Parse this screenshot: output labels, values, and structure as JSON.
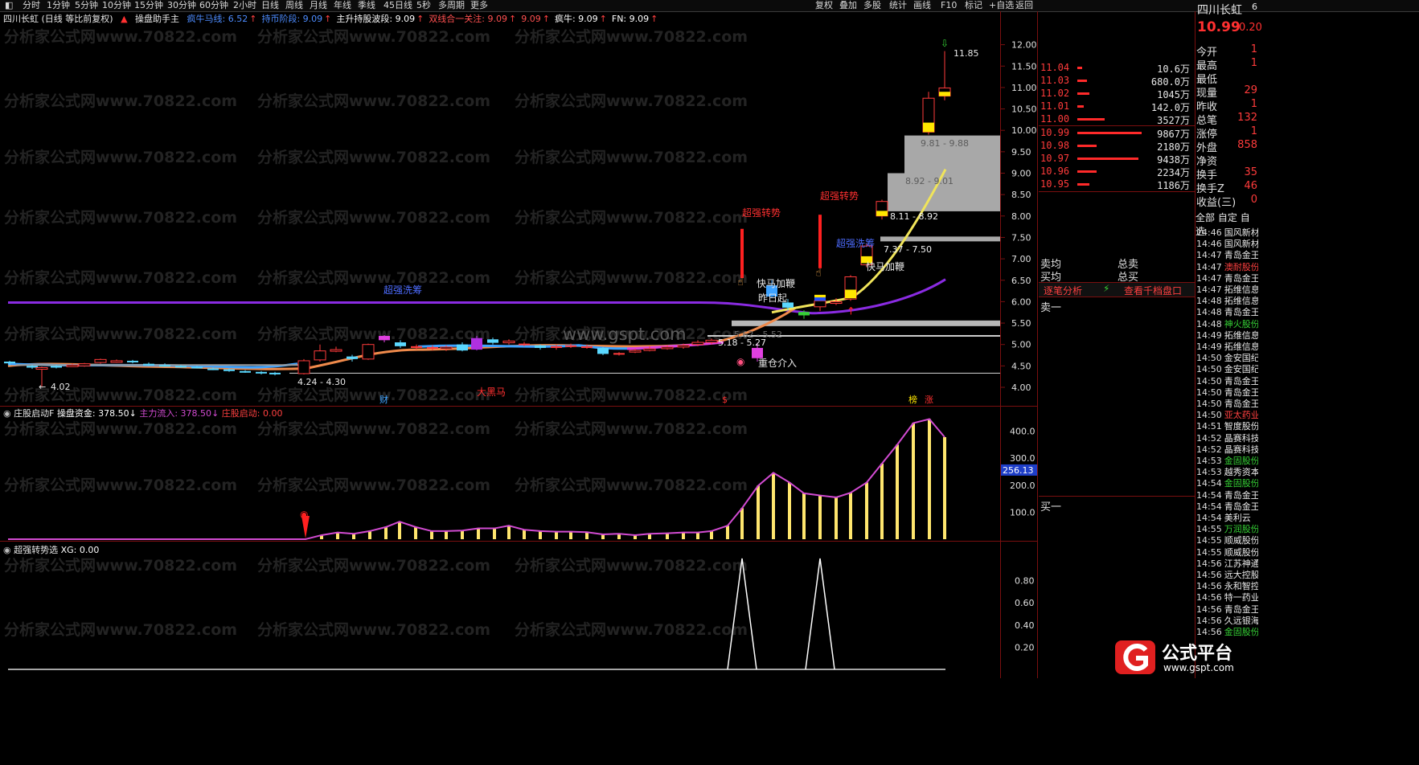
{
  "toolbar": {
    "periods": [
      "分时",
      "1分钟",
      "5分钟",
      "10分钟",
      "15分钟",
      "30分钟",
      "60分钟",
      "2小时",
      "日线",
      "周线",
      "月线",
      "年线",
      "季线",
      "45日线",
      "5秒",
      "多周期",
      "更多"
    ],
    "right_buttons": [
      "复权",
      "叠加",
      "多股",
      "统计",
      "画线",
      "F10",
      "标记",
      "+自选",
      "返回"
    ]
  },
  "info": {
    "stock": "四川长虹 (日线 等比前复权)",
    "indicator": "操盘助手主",
    "items": [
      {
        "label": "疯牛马线: 6.52",
        "color": "#4d8cff"
      },
      {
        "label": "持币阶段: 9.09",
        "color": "#4d8cff"
      },
      {
        "label": "主升持股波段: 9.09",
        "color": "#ffffff"
      },
      {
        "label": "双线合一关注: 9.09",
        "color": "#ff5050"
      },
      {
        "label": "9.09",
        "color": "#ff5050"
      },
      {
        "label": "疯牛: 9.09",
        "color": "#ffffff"
      },
      {
        "label": "FN: 9.09",
        "color": "#ffffff"
      }
    ]
  },
  "main_axis": [
    "12.00",
    "11.50",
    "11.00",
    "10.50",
    "10.00",
    "9.50",
    "9.00",
    "8.50",
    "8.00",
    "7.50",
    "7.00",
    "6.50",
    "6.00",
    "5.50",
    "5.00",
    "4.50",
    "4.00"
  ],
  "annotations": {
    "high": "11.85",
    "low": "4.02",
    "zone1": "9.81 - 9.88",
    "zone2": "8.92 - 9.01",
    "zone3": "8.11 - 8.92",
    "zone4": "7.37 - 7.50",
    "zone5": "5.62 - 5.52",
    "zone6": "5.18 - 5.27",
    "zone7": "4.24 - 4.30",
    "cxqs1": "超强转势",
    "cxqs2": "超强转势",
    "cxxp1": "超强洗筹",
    "cxxp2": "超强洗筹",
    "kmjb1": "快马加鞭",
    "kmjb2": "快马加鞭",
    "zrst": "昨日起",
    "zcjr": "重仓介入",
    "dhm": "大黑马",
    "cai": "财",
    "bang": "榜",
    "zhang": "涨",
    "s": "$",
    "watermark_center": "www.gspt.com"
  },
  "panel2": {
    "title": "庄股启动F",
    "fund": "操盘资金: 378.50",
    "main_inflow": "主力流入: 378.50",
    "start": "庄股启动: 0.00",
    "axis": [
      "400.0",
      "300.0",
      "200.0",
      "100.0"
    ],
    "current": "256.13"
  },
  "panel3": {
    "title": "超强转势选",
    "xg": "XG: 0.00",
    "axis": [
      "0.80",
      "0.60",
      "0.40",
      "0.20"
    ]
  },
  "quote": {
    "name": "四川长虹",
    "price": "10.99",
    "change": "0.20",
    "code_hint": "6",
    "rows": [
      {
        "label": "今开",
        "value": "1"
      },
      {
        "label": "最高",
        "value": "1"
      },
      {
        "label": "最低",
        "value": ""
      },
      {
        "label": "现量",
        "value": "29"
      },
      {
        "label": "昨收",
        "value": "1"
      },
      {
        "label": "总笔",
        "value": "132"
      },
      {
        "label": "涨停",
        "value": "1"
      },
      {
        "label": "外盘",
        "value": "858"
      },
      {
        "label": "净资",
        "value": ""
      },
      {
        "label": "换手",
        "value": "35"
      },
      {
        "label": "换手Z",
        "value": "46"
      },
      {
        "label": "收益(三)",
        "value": "0"
      }
    ],
    "tabs": [
      "全部",
      "自定",
      "自选"
    ]
  },
  "orderbook": {
    "sell": [
      {
        "price": "11.04",
        "vol": "10.6万",
        "bar": 0.03
      },
      {
        "price": "11.03",
        "vol": "680.0万",
        "bar": 0.1
      },
      {
        "price": "11.02",
        "vol": "1045万",
        "bar": 0.14
      },
      {
        "price": "11.01",
        "vol": "142.0万",
        "bar": 0.05
      },
      {
        "price": "11.00",
        "vol": "3527万",
        "bar": 0.4
      }
    ],
    "buy": [
      {
        "price": "10.99",
        "vol": "9867万",
        "bar": 1.0
      },
      {
        "price": "10.98",
        "vol": "2180万",
        "bar": 0.26
      },
      {
        "price": "10.97",
        "vol": "9438万",
        "bar": 0.95
      },
      {
        "price": "10.96",
        "vol": "2234万",
        "bar": 0.26
      },
      {
        "price": "10.95",
        "vol": "1186万",
        "bar": 0.14
      }
    ],
    "sell_avg": "卖均",
    "sell_total": "总卖",
    "buy_avg": "买均",
    "buy_total": "总买",
    "tick_analysis": "逐笔分析",
    "view_levels": "查看千档盘口",
    "sell1": "卖一",
    "buy1": "买一"
  },
  "tape": [
    {
      "t": "14:46",
      "n": "国风新材",
      "c": "#e8e8e8"
    },
    {
      "t": "14:46",
      "n": "国风新材",
      "c": "#e8e8e8"
    },
    {
      "t": "14:47",
      "n": "青岛金王",
      "c": "#e8e8e8"
    },
    {
      "t": "14:47",
      "n": "澳耐股份",
      "c": "#ff4040"
    },
    {
      "t": "14:47",
      "n": "青岛金王",
      "c": "#e8e8e8"
    },
    {
      "t": "14:47",
      "n": "拓维信息",
      "c": "#e8e8e8"
    },
    {
      "t": "14:48",
      "n": "拓维信息",
      "c": "#e8e8e8"
    },
    {
      "t": "14:48",
      "n": "青岛金王",
      "c": "#e8e8e8"
    },
    {
      "t": "14:48",
      "n": "神火股份",
      "c": "#35d035"
    },
    {
      "t": "14:49",
      "n": "拓维信息",
      "c": "#e8e8e8"
    },
    {
      "t": "14:49",
      "n": "拓维信息",
      "c": "#e8e8e8"
    },
    {
      "t": "14:50",
      "n": "金安国纪",
      "c": "#e8e8e8"
    },
    {
      "t": "14:50",
      "n": "金安国纪",
      "c": "#e8e8e8"
    },
    {
      "t": "14:50",
      "n": "青岛金王",
      "c": "#e8e8e8"
    },
    {
      "t": "14:50",
      "n": "青岛金王",
      "c": "#e8e8e8"
    },
    {
      "t": "14:50",
      "n": "青岛金王",
      "c": "#e8e8e8"
    },
    {
      "t": "14:50",
      "n": "亚太药业",
      "c": "#ff4040"
    },
    {
      "t": "14:51",
      "n": "智度股份",
      "c": "#e8e8e8"
    },
    {
      "t": "14:52",
      "n": "晶赛科技",
      "c": "#e8e8e8"
    },
    {
      "t": "14:52",
      "n": "晶赛科技",
      "c": "#e8e8e8"
    },
    {
      "t": "14:53",
      "n": "金固股份",
      "c": "#35d035"
    },
    {
      "t": "14:53",
      "n": "越秀资本",
      "c": "#e8e8e8"
    },
    {
      "t": "14:54",
      "n": "金固股份",
      "c": "#35d035"
    },
    {
      "t": "14:54",
      "n": "青岛金王",
      "c": "#e8e8e8"
    },
    {
      "t": "14:54",
      "n": "青岛金王",
      "c": "#e8e8e8"
    },
    {
      "t": "14:54",
      "n": "美利云",
      "c": "#e8e8e8"
    },
    {
      "t": "14:55",
      "n": "万润股份",
      "c": "#35d035"
    },
    {
      "t": "14:55",
      "n": "顺威股份",
      "c": "#e8e8e8"
    },
    {
      "t": "14:55",
      "n": "顺威股份",
      "c": "#e8e8e8"
    },
    {
      "t": "14:56",
      "n": "江苏神通",
      "c": "#e8e8e8"
    },
    {
      "t": "14:56",
      "n": "远大控股",
      "c": "#e8e8e8"
    },
    {
      "t": "14:56",
      "n": "永和智控",
      "c": "#e8e8e8"
    },
    {
      "t": "14:56",
      "n": "特一药业",
      "c": "#e8e8e8"
    },
    {
      "t": "14:56",
      "n": "青岛金王",
      "c": "#e8e8e8"
    },
    {
      "t": "14:56",
      "n": "久远银海",
      "c": "#e8e8e8"
    },
    {
      "t": "14:56",
      "n": "金固股份",
      "c": "#35d035"
    }
  ],
  "watermark": "分析家公式网www.70822.com",
  "logo": {
    "name": "公式平台",
    "url_text": "www.gspt.com"
  }
}
